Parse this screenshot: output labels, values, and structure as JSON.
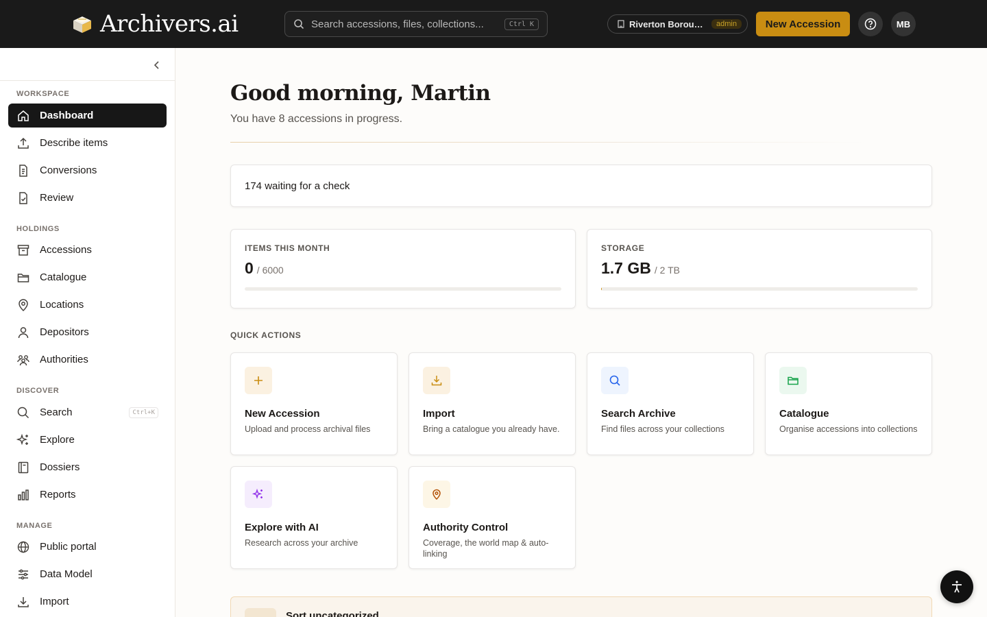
{
  "app": {
    "name": "Archivers.ai"
  },
  "topbar": {
    "search_placeholder": "Search accessions, files, collections...",
    "search_shortcut": "Ctrl K",
    "org_name": "Riverton Boroug...",
    "org_role": "admin",
    "new_accession_label": "New Accession",
    "avatar_initials": "MB"
  },
  "sidebar": {
    "sections": [
      {
        "label": "WORKSPACE",
        "items": [
          {
            "label": "Dashboard",
            "icon": "home-icon",
            "active": true
          },
          {
            "label": "Describe items",
            "icon": "upload-icon"
          },
          {
            "label": "Conversions",
            "icon": "file-convert-icon"
          },
          {
            "label": "Review",
            "icon": "file-check-icon"
          }
        ]
      },
      {
        "label": "HOLDINGS",
        "items": [
          {
            "label": "Accessions",
            "icon": "archive-box-icon"
          },
          {
            "label": "Catalogue",
            "icon": "folder-icon"
          },
          {
            "label": "Locations",
            "icon": "map-pin-icon"
          },
          {
            "label": "Depositors",
            "icon": "user-icon"
          },
          {
            "label": "Authorities",
            "icon": "people-group-icon"
          }
        ]
      },
      {
        "label": "DISCOVER",
        "items": [
          {
            "label": "Search",
            "icon": "search-icon",
            "shortcut": "Ctrl+K"
          },
          {
            "label": "Explore",
            "icon": "sparkles-icon"
          },
          {
            "label": "Dossiers",
            "icon": "book-icon"
          },
          {
            "label": "Reports",
            "icon": "bar-chart-icon"
          }
        ]
      },
      {
        "label": "MANAGE",
        "items": [
          {
            "label": "Public portal",
            "icon": "globe-icon"
          },
          {
            "label": "Data Model",
            "icon": "sliders-icon"
          },
          {
            "label": "Import",
            "icon": "download-icon"
          }
        ]
      }
    ]
  },
  "main": {
    "greeting": "Good morning, Martin",
    "subtext": "You have 8 accessions in progress.",
    "check_text": "174 waiting for a check",
    "stats": [
      {
        "label": "ITEMS THIS MONTH",
        "value": "0",
        "limit": "/ 6000",
        "fraction": 0.0
      },
      {
        "label": "STORAGE",
        "value": "1.7 GB",
        "limit": "/ 2 TB",
        "fraction": 0.001
      }
    ],
    "quick_actions_label": "QUICK ACTIONS",
    "quick_actions": [
      {
        "title": "New Accession",
        "desc": "Upload and process archival files",
        "icon": "plus-icon",
        "color": "#c98d12",
        "bg": "#fbf1e1"
      },
      {
        "title": "Import",
        "desc": "Bring a catalogue you already have.",
        "icon": "download-icon",
        "color": "#c98d12",
        "bg": "#fbf1e1"
      },
      {
        "title": "Search Archive",
        "desc": "Find files across your collections",
        "icon": "search-icon",
        "color": "#2563eb",
        "bg": "#eef4fe"
      },
      {
        "title": "Catalogue",
        "desc": "Organise accessions into collections",
        "icon": "folder-icon",
        "color": "#16a34a",
        "bg": "#ebf8ef"
      },
      {
        "title": "Explore with AI",
        "desc": "Research across your archive",
        "icon": "sparkles-icon",
        "color": "#9333ea",
        "bg": "#f5edfd"
      },
      {
        "title": "Authority Control",
        "desc": "Coverage, the world map & auto-linking",
        "icon": "map-pin-icon",
        "color": "#b45309",
        "bg": "#fdf6e6"
      }
    ],
    "sort_title": "Sort uncategorized"
  }
}
